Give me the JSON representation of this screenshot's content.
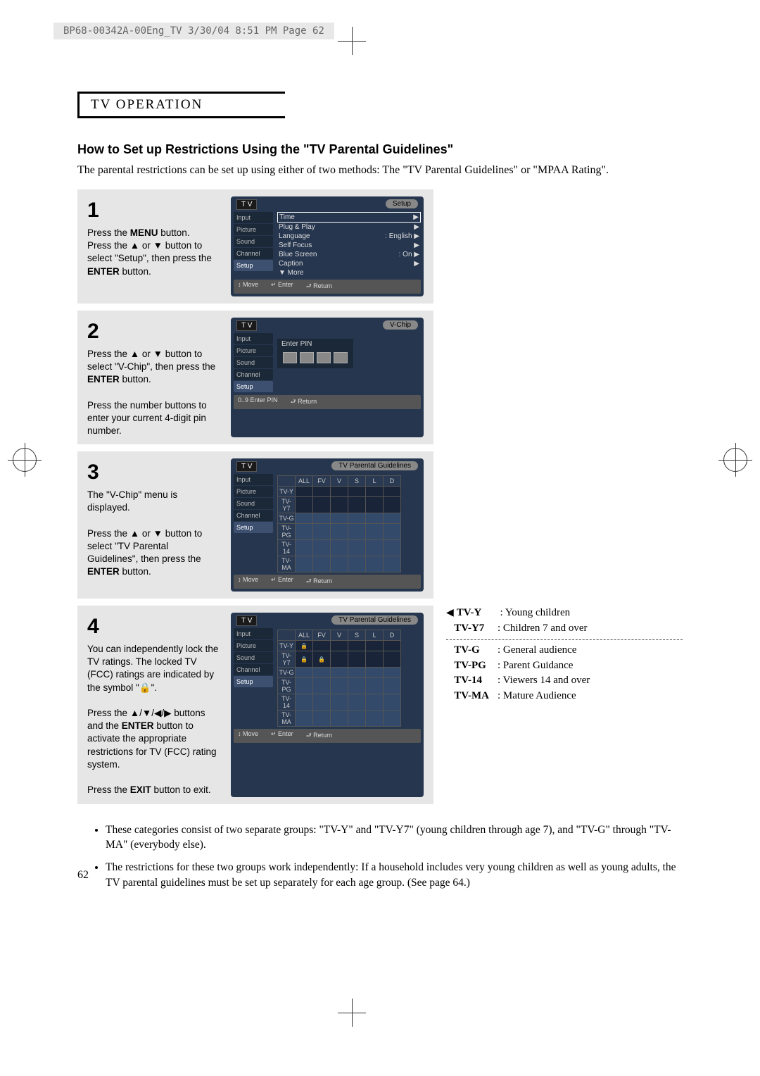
{
  "doc_header": "BP68-00342A-00Eng_TV   3/30/04  8:51 PM  Page 62",
  "section": "TV OPERATION",
  "title": "How to Set up Restrictions Using the \"TV Parental Guidelines\"",
  "intro": "The parental restrictions can be set up using either of two methods: The \"TV Parental Guidelines\" or \"MPAA Rating\".",
  "steps": [
    {
      "n": "1",
      "text": "Press the <b>MENU</b> button.<br>Press the ▲ or ▼ button to select \"Setup\", then press the <b>ENTER</b> button."
    },
    {
      "n": "2",
      "text": "Press the ▲ or ▼ button to select \"V-Chip\", then press the <b>ENTER</b> button.<br><br>Press the number buttons to enter your current 4-digit pin number."
    },
    {
      "n": "3",
      "text": "The \"V-Chip\" menu is displayed.<br><br>Press the ▲ or ▼ button to select \"TV Parental Guidelines\", then press the <b>ENTER</b> button."
    },
    {
      "n": "4",
      "text": "You can independently lock the TV ratings. The locked TV (FCC) ratings are indicated by the symbol \"🔒\".<br><br>Press the ▲/▼/◀/▶ buttons and the <b>ENTER</b> button to activate the appropriate restrictions for TV (FCC) rating system.<br><br>Press the <b>EXIT</b> button to exit."
    }
  ],
  "osd1": {
    "pill": "Setup",
    "tabs": [
      "Input",
      "Picture",
      "Sound",
      "Channel",
      "Setup"
    ],
    "items": [
      {
        "k": "Time",
        "hl": true,
        "v": "▶"
      },
      {
        "k": "Plug & Play",
        "v": "▶"
      },
      {
        "k": "Language",
        "v": ": English   ▶"
      },
      {
        "k": "Self Focus",
        "v": "▶"
      },
      {
        "k": "Blue Screen",
        "v": ": On   ▶"
      },
      {
        "k": "Caption",
        "v": "▶"
      },
      {
        "k": "▼ More",
        "v": ""
      }
    ],
    "foot": [
      "↕ Move",
      "↵ Enter",
      "⮐ Return"
    ]
  },
  "osd2": {
    "pill": "V-Chip",
    "label": "Enter PIN",
    "foot": [
      "0..9  Enter PIN",
      "⮐ Return"
    ]
  },
  "osd3": {
    "pill": "TV Parental Guidelines",
    "cols": [
      "ALL",
      "FV",
      "V",
      "S",
      "L",
      "D"
    ],
    "rows": [
      "TV-Y",
      "TV-Y7",
      "TV-G",
      "TV-PG",
      "TV-14",
      "TV-MA"
    ],
    "foot": [
      "↕ Move",
      "↵ Enter",
      "⮐ Return"
    ]
  },
  "osd4": {
    "pill": "TV Parental Guidelines",
    "cols": [
      "ALL",
      "FV",
      "V",
      "S",
      "L",
      "D"
    ],
    "rows": [
      "TV-Y",
      "TV-Y7",
      "TV-G",
      "TV-PG",
      "TV-14",
      "TV-MA"
    ],
    "locks": [
      [
        0,
        0
      ],
      [
        1,
        0
      ],
      [
        1,
        1
      ]
    ],
    "foot": [
      "↕ Move",
      "↵ Enter",
      "⮐ Return"
    ]
  },
  "legend": {
    "upper": [
      [
        "TV-Y",
        ": Young children"
      ],
      [
        "TV-Y7",
        ": Children 7 and over"
      ]
    ],
    "lower": [
      [
        "TV-G",
        ": General audience"
      ],
      [
        "TV-PG",
        ": Parent Guidance"
      ],
      [
        "TV-14",
        ": Viewers 14 and over"
      ],
      [
        "TV-MA",
        ": Mature Audience"
      ]
    ]
  },
  "bullets": [
    "These categories consist of two separate groups: \"TV-Y\" and \"TV-Y7\" (young children through age 7), and \"TV-G\" through \"TV-MA\" (everybody else).",
    "The restrictions for these two groups work independently: If a household includes very young children as well as young adults, the TV parental guidelines must be set up separately for each age group. (See page 64.)"
  ],
  "pagenum": "62"
}
